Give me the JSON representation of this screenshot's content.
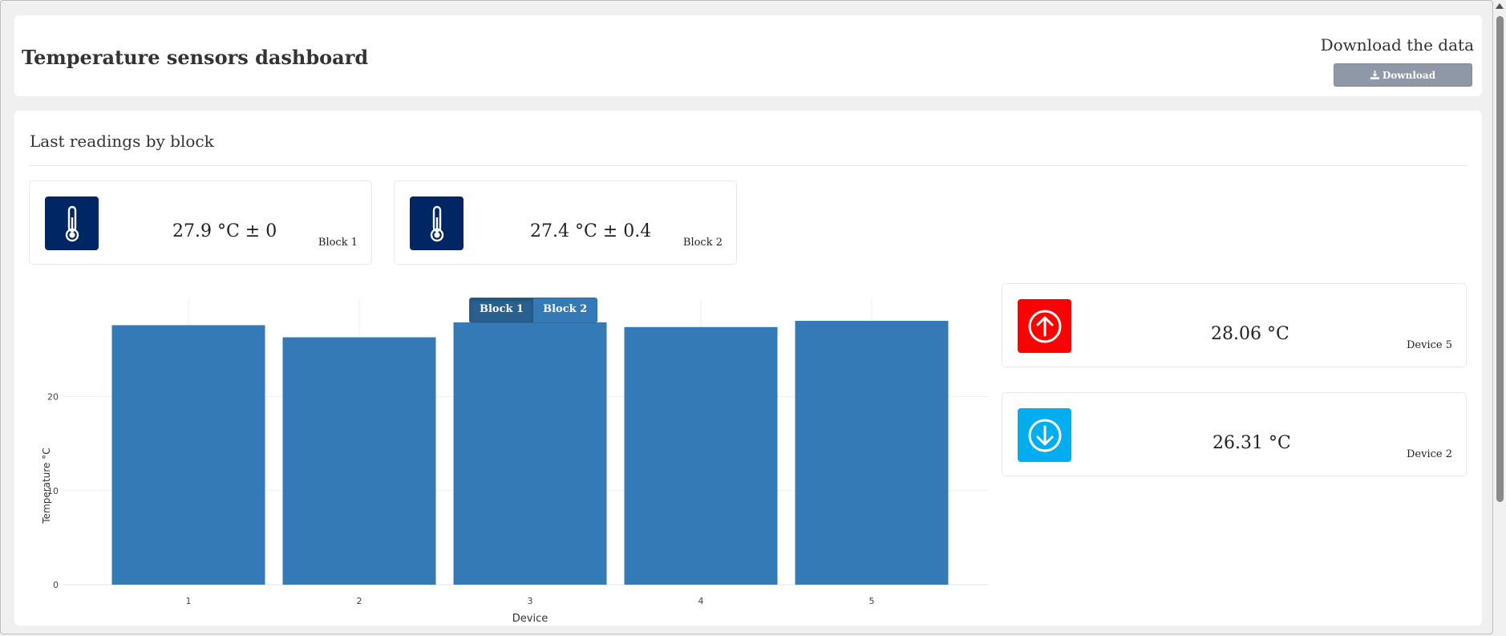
{
  "header": {
    "title": "Temperature sensors dashboard",
    "download_title": "Download the data",
    "download_label": "Download"
  },
  "section": {
    "title": "Last readings by block"
  },
  "blocks": [
    {
      "value": "27.9 °C ± 0",
      "label": "Block 1",
      "icon": "thermometer-icon",
      "color": "#002664"
    },
    {
      "value": "27.4 °C ± 0.4",
      "label": "Block 2",
      "icon": "thermometer-icon",
      "color": "#002664"
    }
  ],
  "extremes": [
    {
      "value": "28.06 °C",
      "label": "Device 5",
      "icon": "arrow-up-circle-icon",
      "color": "#ff0000"
    },
    {
      "value": "26.31 °C",
      "label": "Device 2",
      "icon": "arrow-down-circle-icon",
      "color": "#00aef0"
    }
  ],
  "toggle": {
    "options": [
      "Block 1",
      "Block 2"
    ],
    "selected": "Block 1"
  },
  "chart_data": {
    "type": "bar",
    "categories": [
      "1",
      "2",
      "3",
      "4",
      "5"
    ],
    "values": [
      27.6,
      26.31,
      27.9,
      27.4,
      28.06
    ],
    "xlabel": "Device",
    "ylabel": "Temperature °C",
    "ylim": [
      0,
      29.6
    ],
    "yticks": [
      0,
      10,
      20
    ],
    "grid": true,
    "bar_color": "#337ab7"
  }
}
